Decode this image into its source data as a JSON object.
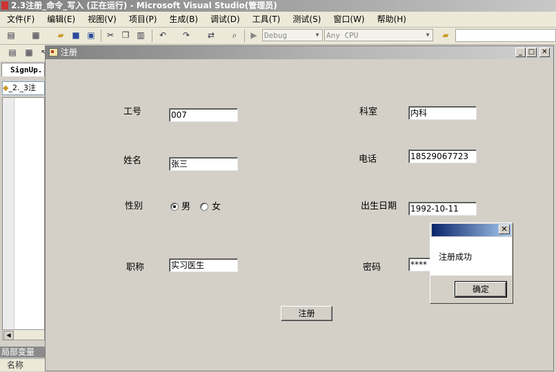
{
  "window": {
    "title": "2.3注册_命令_写入 (正在运行) - Microsoft Visual Studio(管理员)"
  },
  "menu": [
    "文件(F)",
    "编辑(E)",
    "视图(V)",
    "项目(P)",
    "生成(B)",
    "调试(D)",
    "工具(T)",
    "测试(S)",
    "窗口(W)",
    "帮助(H)"
  ],
  "toolbar": {
    "config": "Debug",
    "platform": "Any CPU"
  },
  "editor": {
    "doc_tab": "SignUp.",
    "code_combo": "_2._3注"
  },
  "locals": {
    "title": "局部变量",
    "name_col": "名称"
  },
  "form": {
    "title": "注册",
    "labels": {
      "id": "工号",
      "dept": "科室",
      "name": "姓名",
      "phone": "电话",
      "gender": "性别",
      "birth": "出生日期",
      "job_title": "职称",
      "password": "密码"
    },
    "values": {
      "id": "007",
      "dept": "内科",
      "name": "张三",
      "phone": "18529067723",
      "birth": "1992-10-11",
      "job_title": "实习医生",
      "password": "****"
    },
    "gender_options": [
      "男",
      "女"
    ],
    "gender_selected": "男",
    "register_button": "注册"
  },
  "message_box": {
    "text": "注册成功",
    "ok_button": "确定"
  }
}
